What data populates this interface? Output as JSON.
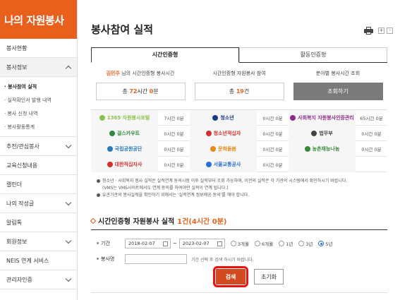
{
  "sidebar": {
    "brand": "나의 자원봉사",
    "items": [
      {
        "label": "봉사현황"
      },
      {
        "label": "봉사정보"
      },
      {
        "label": "추천/관심봉사"
      },
      {
        "label": "교육신청내용"
      },
      {
        "label": "캘린더"
      },
      {
        "label": "나의 작성글"
      },
      {
        "label": "알림톡"
      },
      {
        "label": "회원정보"
      },
      {
        "label": "NEIS 연계 서비스"
      },
      {
        "label": "관리자인증"
      }
    ],
    "submenu": [
      "· 봉사참여 실적",
      "· 실적확인서 발행 내역",
      "· 봉사 신청 내역",
      "· 봉사활동통계"
    ]
  },
  "header": {
    "title": "봉사참여 실적",
    "zoom_in": "+",
    "zoom_out": "-"
  },
  "tabs": [
    {
      "label": "시간인증형"
    },
    {
      "label": "활동인증형"
    }
  ],
  "summary": {
    "user_name": "김민주",
    "col1_label_suffix": " 님의 시간인증형 봉사시간",
    "col1_prefix": "총 ",
    "col1_hours": "72",
    "col1_mid": "시간 ",
    "col1_minutes": "0",
    "col1_suffix": "분",
    "col2_label": "시간인증형 자원봉사 참여",
    "col2_prefix": "총 ",
    "col2_count": "19",
    "col2_suffix": "건",
    "col3_label": "분야별 봉사시간 조회",
    "col3_button": "조회하기"
  },
  "orgs": [
    [
      {
        "name": "1365 자원봉사포털",
        "time": "7시간 0분",
        "color": "#8bc34a"
      },
      {
        "name": "청소년",
        "time": "0시간 0분",
        "color": "#1a3a8a"
      },
      {
        "name": "사회복지 자원봉사인증관리",
        "time": "65시간 0분",
        "color": "#8e2a8a"
      }
    ],
    [
      {
        "name": "걸스카우트",
        "time": "0시간 0분",
        "color": "#2e8b3e"
      },
      {
        "name": "청소년적십자",
        "time": "0시간 0분",
        "color": "#d32f2f"
      },
      {
        "name": "법무부",
        "time": "0시간 0분",
        "color": "#444444"
      }
    ],
    [
      {
        "name": "국립공원공단",
        "time": "0시간 0분",
        "color": "#2a7ab8"
      },
      {
        "name": "문화돌봄",
        "time": "0시간 0분",
        "color": "#e88a1a"
      },
      {
        "name": "농촌재능나눔",
        "time": "0시간 0분",
        "color": "#3a8a3a"
      }
    ],
    [
      {
        "name": "대한적십자사",
        "time": "0시간 0분",
        "color": "#d32f2f"
      },
      {
        "name": "서울교통공사",
        "time": "0시간 0분",
        "color": "#2a6fd6"
      },
      {
        "name": "",
        "time": "",
        "color": "#f6f6f6"
      }
    ]
  ],
  "notes": {
    "line1": "청소년 · 사회복지 봉사 실적은 실적연계 동의시점 이후 실적부터 조회 가능하며, 이전의 실적은 각 기관의 시스템에서 확인하시기 바랍니다.",
    "line2": "(VMS는 VMS사이트에서도 연계 동의를 하여야만 실적이 연계 됩니다.)",
    "line3": "유관기관의 봉사실적을 확인하기 위해서는 '실적연계 정보제공 동의'를 해야 합니다."
  },
  "result": {
    "title": "시간인증형 자원봉사 실적",
    "count": "1건(4시간 0분)"
  },
  "search": {
    "period_label": "기간",
    "start_date": "2018-02-07",
    "end_date": "2023-02-07",
    "tilde": "~",
    "options": [
      {
        "label": "3개월",
        "selected": false
      },
      {
        "label": "6개월",
        "selected": false
      },
      {
        "label": "1년",
        "selected": false
      },
      {
        "label": "3년",
        "selected": false
      },
      {
        "label": "5년",
        "selected": true
      }
    ],
    "name_label": "봉사명",
    "name_value": "",
    "hint": "기간 선택 후 검색 하시기 바랍니다.",
    "search_button": "검색",
    "reset_button": "초기화"
  },
  "colors": {
    "brand": "#e8601c",
    "search_button": "#d34a1e",
    "highlight": "#ee1111"
  }
}
